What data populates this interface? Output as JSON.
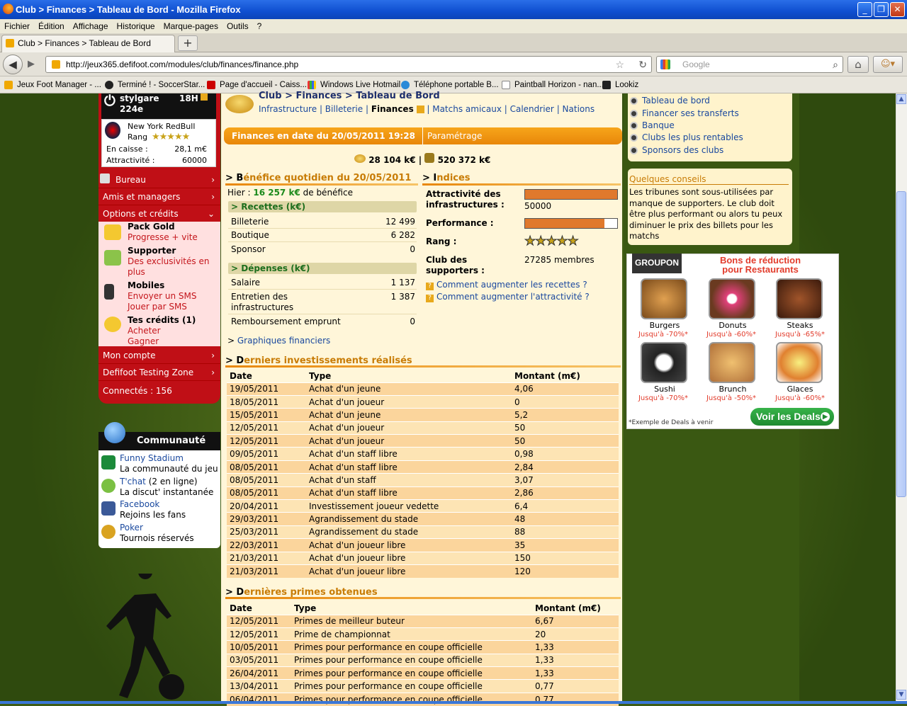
{
  "window": {
    "title": "Club > Finances > Tableau de Bord - Mozilla Firefox"
  },
  "menu": [
    "Fichier",
    "Édition",
    "Affichage",
    "Historique",
    "Marque-pages",
    "Outils",
    "?"
  ],
  "tab": {
    "title": "Club > Finances > Tableau de Bord",
    "new_tab": "+"
  },
  "nav": {
    "url": "http://jeux365.defifoot.com/modules/club/finances/finance.php",
    "search_placeholder": "Google"
  },
  "bookmarks": [
    "Jeux Foot Manager - ...",
    "Terminé ! - SoccerStar...",
    "Page d'accueil - Caiss...",
    "Windows Live Hotmail",
    "Téléphone portable B...",
    "Paintball Horizon - nan...",
    "Lookiz"
  ],
  "user": {
    "name": "stylgare",
    "score": "224e",
    "time": "18H"
  },
  "club": {
    "name": "New York RedBull",
    "rank_label": "Rang",
    "cash_label": "En caisse :",
    "cash": "28,1 m€",
    "attract_label": "Attractivité :",
    "attract": "60000"
  },
  "leftmenu": {
    "bureau": "Bureau",
    "amis": "Amis et managers",
    "options": "Options et crédits",
    "compte": "Mon compte",
    "testing": "Defifoot Testing Zone",
    "connectes": "Connectés : 156"
  },
  "options": [
    {
      "title": "Pack Gold",
      "sub1": "Progresse + vite",
      "sub2": ""
    },
    {
      "title": "Supporter",
      "sub1": "Des exclusivités en",
      "sub2": "plus"
    },
    {
      "title": "Mobiles",
      "sub1": "Envoyer un SMS",
      "sub2": "Jouer par SMS"
    },
    {
      "title": "Tes crédits (1)",
      "sub1": "Acheter",
      "sub2": "Gagner"
    }
  ],
  "community": {
    "title": "Communauté",
    "items": [
      {
        "link": "Funny Stadium",
        "desc": "La communauté du jeu"
      },
      {
        "link": "T'chat",
        "extra": "(2 en ligne)",
        "desc": "La discut' instantanée"
      },
      {
        "link": "Facebook",
        "desc": "Rejoins les fans"
      },
      {
        "link": "Poker",
        "desc": "Tournois réservés"
      }
    ]
  },
  "page": {
    "breadcrumb": "Club > Finances > Tableau de Bord",
    "subnav": [
      "Infrastructure",
      "Billeterie",
      "Finances",
      "Matchs amicaux",
      "Calendrier",
      "Nations"
    ],
    "fin_header": "Finances en date du 20/05/2011 19:28",
    "param": "Paramétrage",
    "money1": "28 104 k€",
    "money2": "520 372 k€"
  },
  "benefice": {
    "heading_first": "B",
    "heading_rest": "énéfice quotidien du 20/05/2011",
    "hier_label": "Hier :",
    "hier_value": "16 257 k€",
    "hier_suffix": "de bénéfice",
    "recettes_title": "Recettes (k€)",
    "recettes": [
      [
        "Billeterie",
        "12 499"
      ],
      [
        "Boutique",
        "6 282"
      ],
      [
        "Sponsor",
        "0"
      ]
    ],
    "depenses_title": "Dépenses (k€)",
    "depenses": [
      [
        "Salaire",
        "1 137"
      ],
      [
        "Entretien des infrastructures",
        "1 387"
      ],
      [
        "Remboursement emprunt",
        "0"
      ]
    ],
    "graph_link": "Graphiques financiers"
  },
  "indices": {
    "heading_first": "I",
    "heading_rest": "ndices",
    "attract_label": "Attractivité des infrastructures :",
    "attract_value": "50000",
    "attract_fill": 1.0,
    "perf_label": "Performance :",
    "perf_fill": 0.86,
    "rang_label": "Rang :",
    "rang_stars": 5,
    "supporters_label": "Club des supporters :",
    "supporters_value": "27285 membres",
    "q1": "Comment augmenter les recettes ?",
    "q2": "Comment augmenter l'attractivité ?"
  },
  "investments": {
    "heading_first": "D",
    "heading_rest": "erniers investissements réalisés",
    "headers": [
      "Date",
      "Type",
      "Montant (m€)"
    ],
    "rows": [
      [
        "19/05/2011",
        "Achat d'un jeune",
        "4,06"
      ],
      [
        "18/05/2011",
        "Achat d'un joueur",
        "0"
      ],
      [
        "15/05/2011",
        "Achat d'un jeune",
        "5,2"
      ],
      [
        "12/05/2011",
        "Achat d'un joueur",
        "50"
      ],
      [
        "12/05/2011",
        "Achat d'un joueur",
        "50"
      ],
      [
        "09/05/2011",
        "Achat d'un staff libre",
        "0,98"
      ],
      [
        "08/05/2011",
        "Achat d'un staff libre",
        "2,84"
      ],
      [
        "08/05/2011",
        "Achat d'un staff",
        "3,07"
      ],
      [
        "08/05/2011",
        "Achat d'un staff libre",
        "2,86"
      ],
      [
        "20/04/2011",
        "Investissement joueur vedette",
        "6,4"
      ],
      [
        "29/03/2011",
        "Agrandissement du stade",
        "48"
      ],
      [
        "25/03/2011",
        "Agrandissement du stade",
        "88"
      ],
      [
        "22/03/2011",
        "Achat d'un joueur libre",
        "35"
      ],
      [
        "21/03/2011",
        "Achat d'un joueur libre",
        "150"
      ],
      [
        "21/03/2011",
        "Achat d'un joueur libre",
        "120"
      ]
    ]
  },
  "primes": {
    "heading_first": "D",
    "heading_rest": "ernières primes obtenues",
    "headers": [
      "Date",
      "Type",
      "Montant (m€)"
    ],
    "rows": [
      [
        "12/05/2011",
        "Primes de meilleur buteur",
        "6,67"
      ],
      [
        "12/05/2011",
        "Prime de championnat",
        "20"
      ],
      [
        "10/05/2011",
        "Primes pour performance en coupe officielle",
        "1,33"
      ],
      [
        "03/05/2011",
        "Primes pour performance en coupe officielle",
        "1,33"
      ],
      [
        "26/04/2011",
        "Primes pour performance en coupe officielle",
        "1,33"
      ],
      [
        "13/04/2011",
        "Primes pour performance en coupe officielle",
        "0,77"
      ],
      [
        "06/04/2011",
        "Primes pour performance en coupe officielle",
        "0,77"
      ]
    ]
  },
  "rightlinks": [
    "Tableau de bord",
    "Financer ses transferts",
    "Banque",
    "Clubs les plus rentables",
    "Sponsors des clubs"
  ],
  "tips": {
    "title": "Quelques conseils",
    "text": "Les tribunes sont sous-utilisées par manque de supporters. Le club doit être plus performant ou alors tu peux diminuer le prix des billets pour les matchs"
  },
  "ad": {
    "logo": "GROUPON",
    "title": "Bons de réduction pour Restaurants",
    "items": [
      {
        "name": "Burgers",
        "disc": "Jusqu'à -70%*"
      },
      {
        "name": "Donuts",
        "disc": "Jusqu'à -60%*"
      },
      {
        "name": "Steaks",
        "disc": "Jusqu'à -65%*"
      },
      {
        "name": "Sushi",
        "disc": "Jusqu'à -70%*"
      },
      {
        "name": "Brunch",
        "disc": "Jusqu'à -50%*"
      },
      {
        "name": "Glaces",
        "disc": "Jusqu'à -60%*"
      }
    ],
    "note": "*Exemple de Deals à venir",
    "button": "Voir les Deals"
  }
}
